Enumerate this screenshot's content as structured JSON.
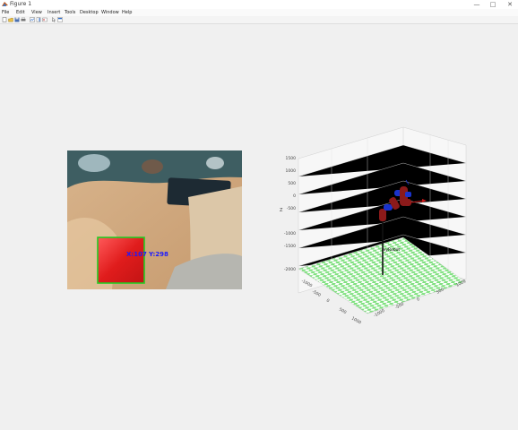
{
  "window": {
    "title": "Figure 1",
    "minimize": "—",
    "maximize": "□",
    "close": "✕"
  },
  "menu": {
    "items": [
      {
        "label": "File"
      },
      {
        "label": "Edit"
      },
      {
        "label": "View"
      },
      {
        "label": "Insert"
      },
      {
        "label": "Tools"
      },
      {
        "label": "Desktop"
      },
      {
        "label": "Window"
      },
      {
        "label": "Help"
      }
    ]
  },
  "toolbar": {
    "buttons": [
      {
        "icon": "new-figure-icon"
      },
      {
        "icon": "open-file-icon"
      },
      {
        "icon": "save-icon"
      },
      {
        "icon": "print-icon"
      },
      {
        "icon": "link-plot-icon"
      },
      {
        "icon": "insert-colorbar-icon"
      },
      {
        "icon": "insert-legend-icon"
      },
      {
        "icon": "pointer-icon"
      },
      {
        "icon": "property-editor-icon"
      }
    ]
  },
  "camera": {
    "x_label": "X:107",
    "y_label": "Y:298",
    "label_color": "#1a1aff",
    "box_color": "#22cc22"
  },
  "plot3d": {
    "z_ticks": [
      "1500",
      "1000",
      "500",
      "0",
      "-500",
      "-1000",
      "-1500",
      "-2000"
    ],
    "x_ticks": [
      "-1000",
      "-500",
      "0",
      "500",
      "1000"
    ],
    "y_ticks": [
      "-1000",
      "-500",
      "0",
      "500",
      "1000"
    ],
    "z_axis_label": "Z",
    "robot_label": "myRobot",
    "floor_colors": [
      "#7fe07f",
      "#ffffff"
    ],
    "robot_color": "#8b1a1a",
    "joint_color": "#1a33cc"
  }
}
